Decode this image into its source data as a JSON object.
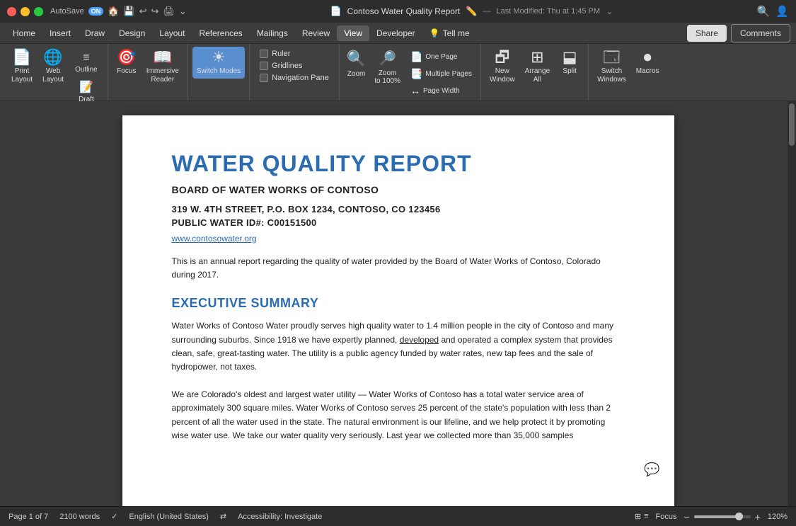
{
  "titleBar": {
    "autosave": "AutoSave",
    "autosaveState": "ON",
    "title": "Contoso Water Quality Report",
    "modified": "Last Modified: Thu at 1:45 PM"
  },
  "menuBar": {
    "items": [
      "Home",
      "Insert",
      "Draw",
      "Design",
      "Layout",
      "References",
      "Mailings",
      "Review",
      "View",
      "Developer",
      "Tell me"
    ]
  },
  "ribbon": {
    "groups": [
      {
        "name": "views",
        "items": [
          {
            "id": "print-layout",
            "icon": "🖨",
            "label": "Print\nLayout"
          },
          {
            "id": "web-layout",
            "icon": "🌐",
            "label": "Web\nLayout"
          }
        ],
        "sideItems": [
          {
            "id": "outline",
            "label": "Outline"
          },
          {
            "id": "draft",
            "label": "Draft"
          }
        ]
      }
    ],
    "checkboxes": [
      {
        "id": "ruler",
        "label": "Ruler",
        "checked": false
      },
      {
        "id": "gridlines",
        "label": "Gridlines",
        "checked": false
      },
      {
        "id": "nav-pane",
        "label": "Navigation Pane",
        "checked": false
      }
    ],
    "zoom": {
      "zoomLabel": "Zoom",
      "zoom100Label": "Zoom\nto 100%",
      "pageWidthLabel": "Page Width",
      "onePageLabel": "One Page",
      "multipleLabel": "Multiple Pages"
    },
    "windowGroup": {
      "newWindowLabel": "New\nWindow",
      "arrangeAllLabel": "Arrange\nAll",
      "splitLabel": "Split"
    },
    "switchModes": {
      "label": "Switch\nWindows"
    },
    "macros": {
      "label": "Macros"
    },
    "shareBtn": "Share",
    "commentsBtn": "Comments"
  },
  "document": {
    "title": "WATER QUALITY REPORT",
    "boardTitle": "BOARD OF WATER WORKS OF CONTOSO",
    "address": "319 W. 4TH STREET, P.O. BOX 1234, CONTOSO, CO 123456",
    "publicId": "PUBLIC WATER ID#: C00151500",
    "website": "www.contosowater.org",
    "intro": "This is an annual report regarding the quality of water provided by the Board of Water Works of Contoso, Colorado during 2017.",
    "executiveSummaryTitle": "EXECUTIVE SUMMARY",
    "para1": "Water Works of Contoso Water proudly serves high quality water to 1.4 million people in the city of Contoso and many surrounding suburbs. Since 1918 we have expertly planned, developed and operated a complex system that provides clean, safe, great-tasting water. The utility is a public agency funded by water rates, new tap fees and the sale of hydropower, not taxes.",
    "para2": "We are Colorado's oldest and largest water utility — Water Works of Contoso has a total water service area of approximately 300 square miles. Water Works of Contoso serves 25 percent of the state's population with less than 2 percent of all the water used in the state. The natural environment is our lifeline, and we help protect it by promoting wise water use. We take our water quality very seriously. Last year we collected more than 35,000 samples"
  },
  "statusBar": {
    "page": "Page 1 of 7",
    "words": "2100 words",
    "language": "English (United States)",
    "accessibility": "Accessibility: Investigate",
    "focus": "Focus",
    "zoom": "120%"
  },
  "focus": {
    "label": "Focus"
  },
  "switchModes": {
    "label": "Switch Modes"
  }
}
